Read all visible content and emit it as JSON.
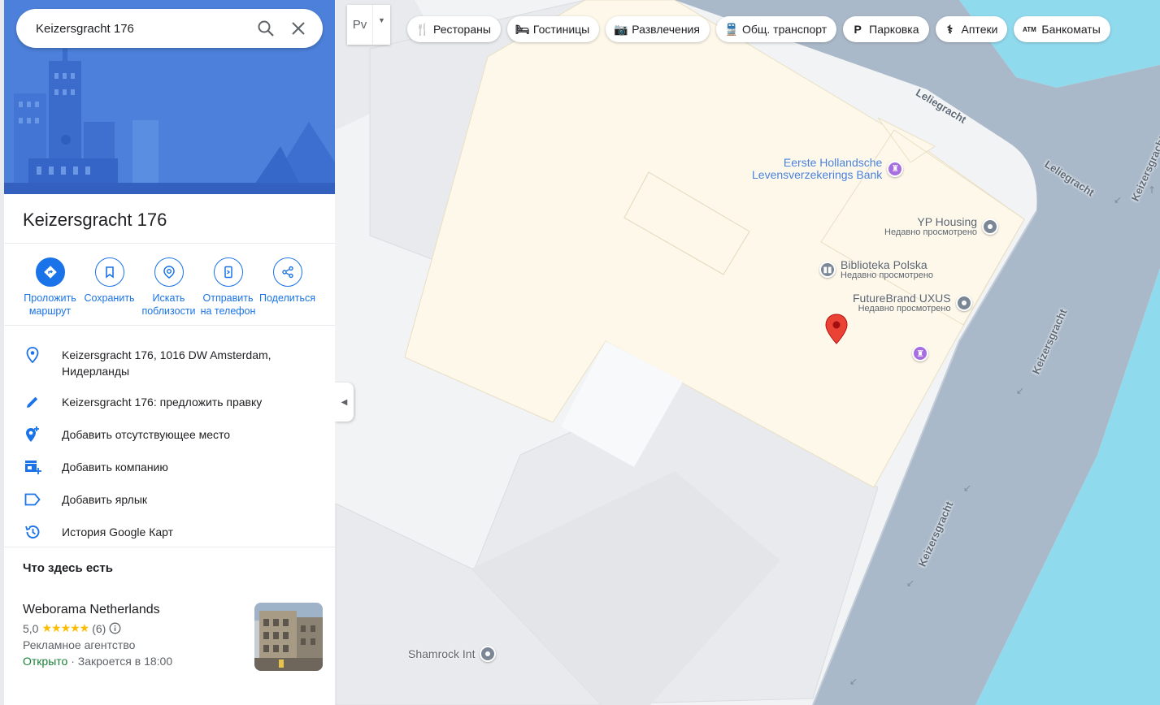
{
  "search": {
    "value": "Keizersgracht 176",
    "search_icon": "search-icon",
    "clear_icon": "close-icon"
  },
  "place": {
    "title": "Keizersgracht 176"
  },
  "actions": [
    {
      "label": "Проложить маршрут",
      "icon": "directions-icon"
    },
    {
      "label": "Сохранить",
      "icon": "bookmark-icon"
    },
    {
      "label": "Искать поблизости",
      "icon": "nearby-icon"
    },
    {
      "label": "Отправить на телефон",
      "icon": "send-to-phone-icon"
    },
    {
      "label": "Поделиться",
      "icon": "share-icon"
    }
  ],
  "info": {
    "address": "Keizersgracht 176, 1016 DW Amsterdam, Нидерланды",
    "suggest_edit": "Keizersgracht 176: предложить правку",
    "add_missing_place": "Добавить отсутствующее место",
    "add_business": "Добавить компанию",
    "add_label": "Добавить ярлык",
    "history": "История Google Карт"
  },
  "here": {
    "title": "Что здесь есть",
    "business": {
      "name": "Weborama Netherlands",
      "rating": "5,0",
      "stars": "★★★★★",
      "count": "(6)",
      "type": "Рекламное агентство",
      "open": "Открыто",
      "closes": " · Закроется в 18:00"
    }
  },
  "layers": {
    "label": "Рv"
  },
  "chips": [
    {
      "label": "Рестораны",
      "icon": "restaurant-icon",
      "glyph": "🍴"
    },
    {
      "label": "Гостиницы",
      "icon": "hotel-icon",
      "glyph": "🛏"
    },
    {
      "label": "Развлечения",
      "icon": "camera-icon",
      "glyph": "📷"
    },
    {
      "label": "Общ. транспорт",
      "icon": "transit-icon",
      "glyph": "🚆"
    },
    {
      "label": "Парковка",
      "icon": "parking-icon",
      "glyph": "P"
    },
    {
      "label": "Аптеки",
      "icon": "pharmacy-icon",
      "glyph": "⚕"
    },
    {
      "label": "Банкоматы",
      "icon": "atm-icon",
      "glyph": "ATM"
    }
  ],
  "map": {
    "streets": {
      "leliegracht_1": "Leliegracht",
      "leliegracht_2": "Leliegracht",
      "keizersgracht_1": "Keizersgracht",
      "keizersgracht_2": "Keizersgracht",
      "keizersgracht_3": "Keizersgracht"
    },
    "pois": {
      "bank_line1": "Eerste Hollandsche",
      "bank_line2": "Levensverzekerings Bank",
      "yp_name": "YP Housing",
      "yp_sub": "Недавно просмотрено",
      "biblioteka_name": "Biblioteka Polska",
      "biblioteka_sub": "Недавно просмотрено",
      "futurebrand_name": "FutureBrand UXUS",
      "futurebrand_sub": "Недавно просмотрено",
      "shamrock_name": "Shamrock Int"
    }
  },
  "colors": {
    "accent": "#1a73e8",
    "water": "#90daee",
    "road": "#aab9c9",
    "building": "#e8eaed",
    "highlight": "#fdf8e9",
    "pin": "#ea4335",
    "open": "#188038",
    "star": "#fbbc04"
  }
}
